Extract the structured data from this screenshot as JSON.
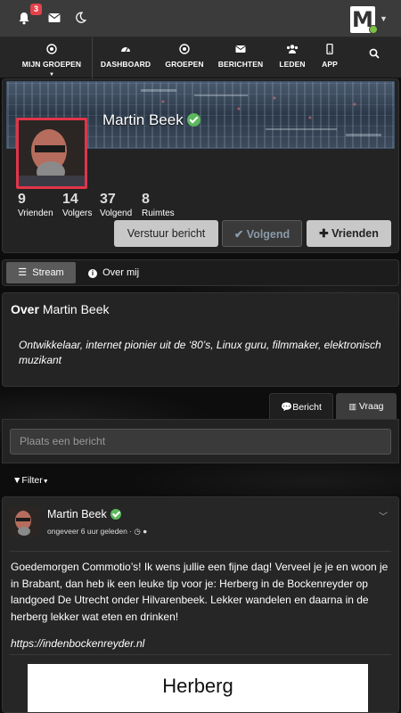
{
  "topbar": {
    "notifications_count": "3",
    "logo_letter": "M"
  },
  "nav": {
    "items": [
      {
        "label": "MIJN GROEPEN",
        "icon": "target-icon"
      },
      {
        "label": "DASHBOARD",
        "icon": "dashboard-icon"
      },
      {
        "label": "GROEPEN",
        "icon": "target-icon"
      },
      {
        "label": "BERICHTEN",
        "icon": "envelope-icon"
      },
      {
        "label": "LEDEN",
        "icon": "users-icon"
      },
      {
        "label": "APP",
        "icon": "mobile-icon"
      }
    ]
  },
  "profile": {
    "name": "Martin Beek",
    "stats": [
      {
        "value": "9",
        "label": "Vrienden"
      },
      {
        "value": "14",
        "label": "Volgers"
      },
      {
        "value": "37",
        "label": "Volgend"
      },
      {
        "value": "8",
        "label": "Ruimtes"
      }
    ],
    "buttons": {
      "message": "Verstuur bericht",
      "following": "Volgend",
      "friends": "Vrienden"
    }
  },
  "tabs": {
    "stream": "Stream",
    "about": "Over mij"
  },
  "about": {
    "heading_bold": "Over",
    "heading_name": "Martin Beek",
    "text": "Ontwikkelaar, internet pionier uit de ‘80’s, Linux guru, filmmaker, elektronisch muzikant"
  },
  "composer": {
    "tab_post": "Bericht",
    "tab_question": "Vraag",
    "placeholder": "Plaats een bericht"
  },
  "filter": {
    "label": "Filter"
  },
  "post": {
    "author": "Martin Beek",
    "time": "ongeveer 6 uur geleden ·",
    "text": "Goedemorgen Commotio’s! Ik wens jullie een fijne dag! Verveel je je en woon je in Brabant, dan heb ik een leuke tip voor je: Herberg in de Bockenreyder op landgoed De Utrecht onder Hilvarenbeek. Lekker wandelen en daarna in de herberg lekker wat eten en drinken!",
    "link": "https://indenbockenreyder.nl",
    "preview_title": "Herberg"
  },
  "colors": {
    "accent_green": "#5cb85c",
    "badge_red": "#e2434b",
    "avatar_border": "#e1354a"
  }
}
